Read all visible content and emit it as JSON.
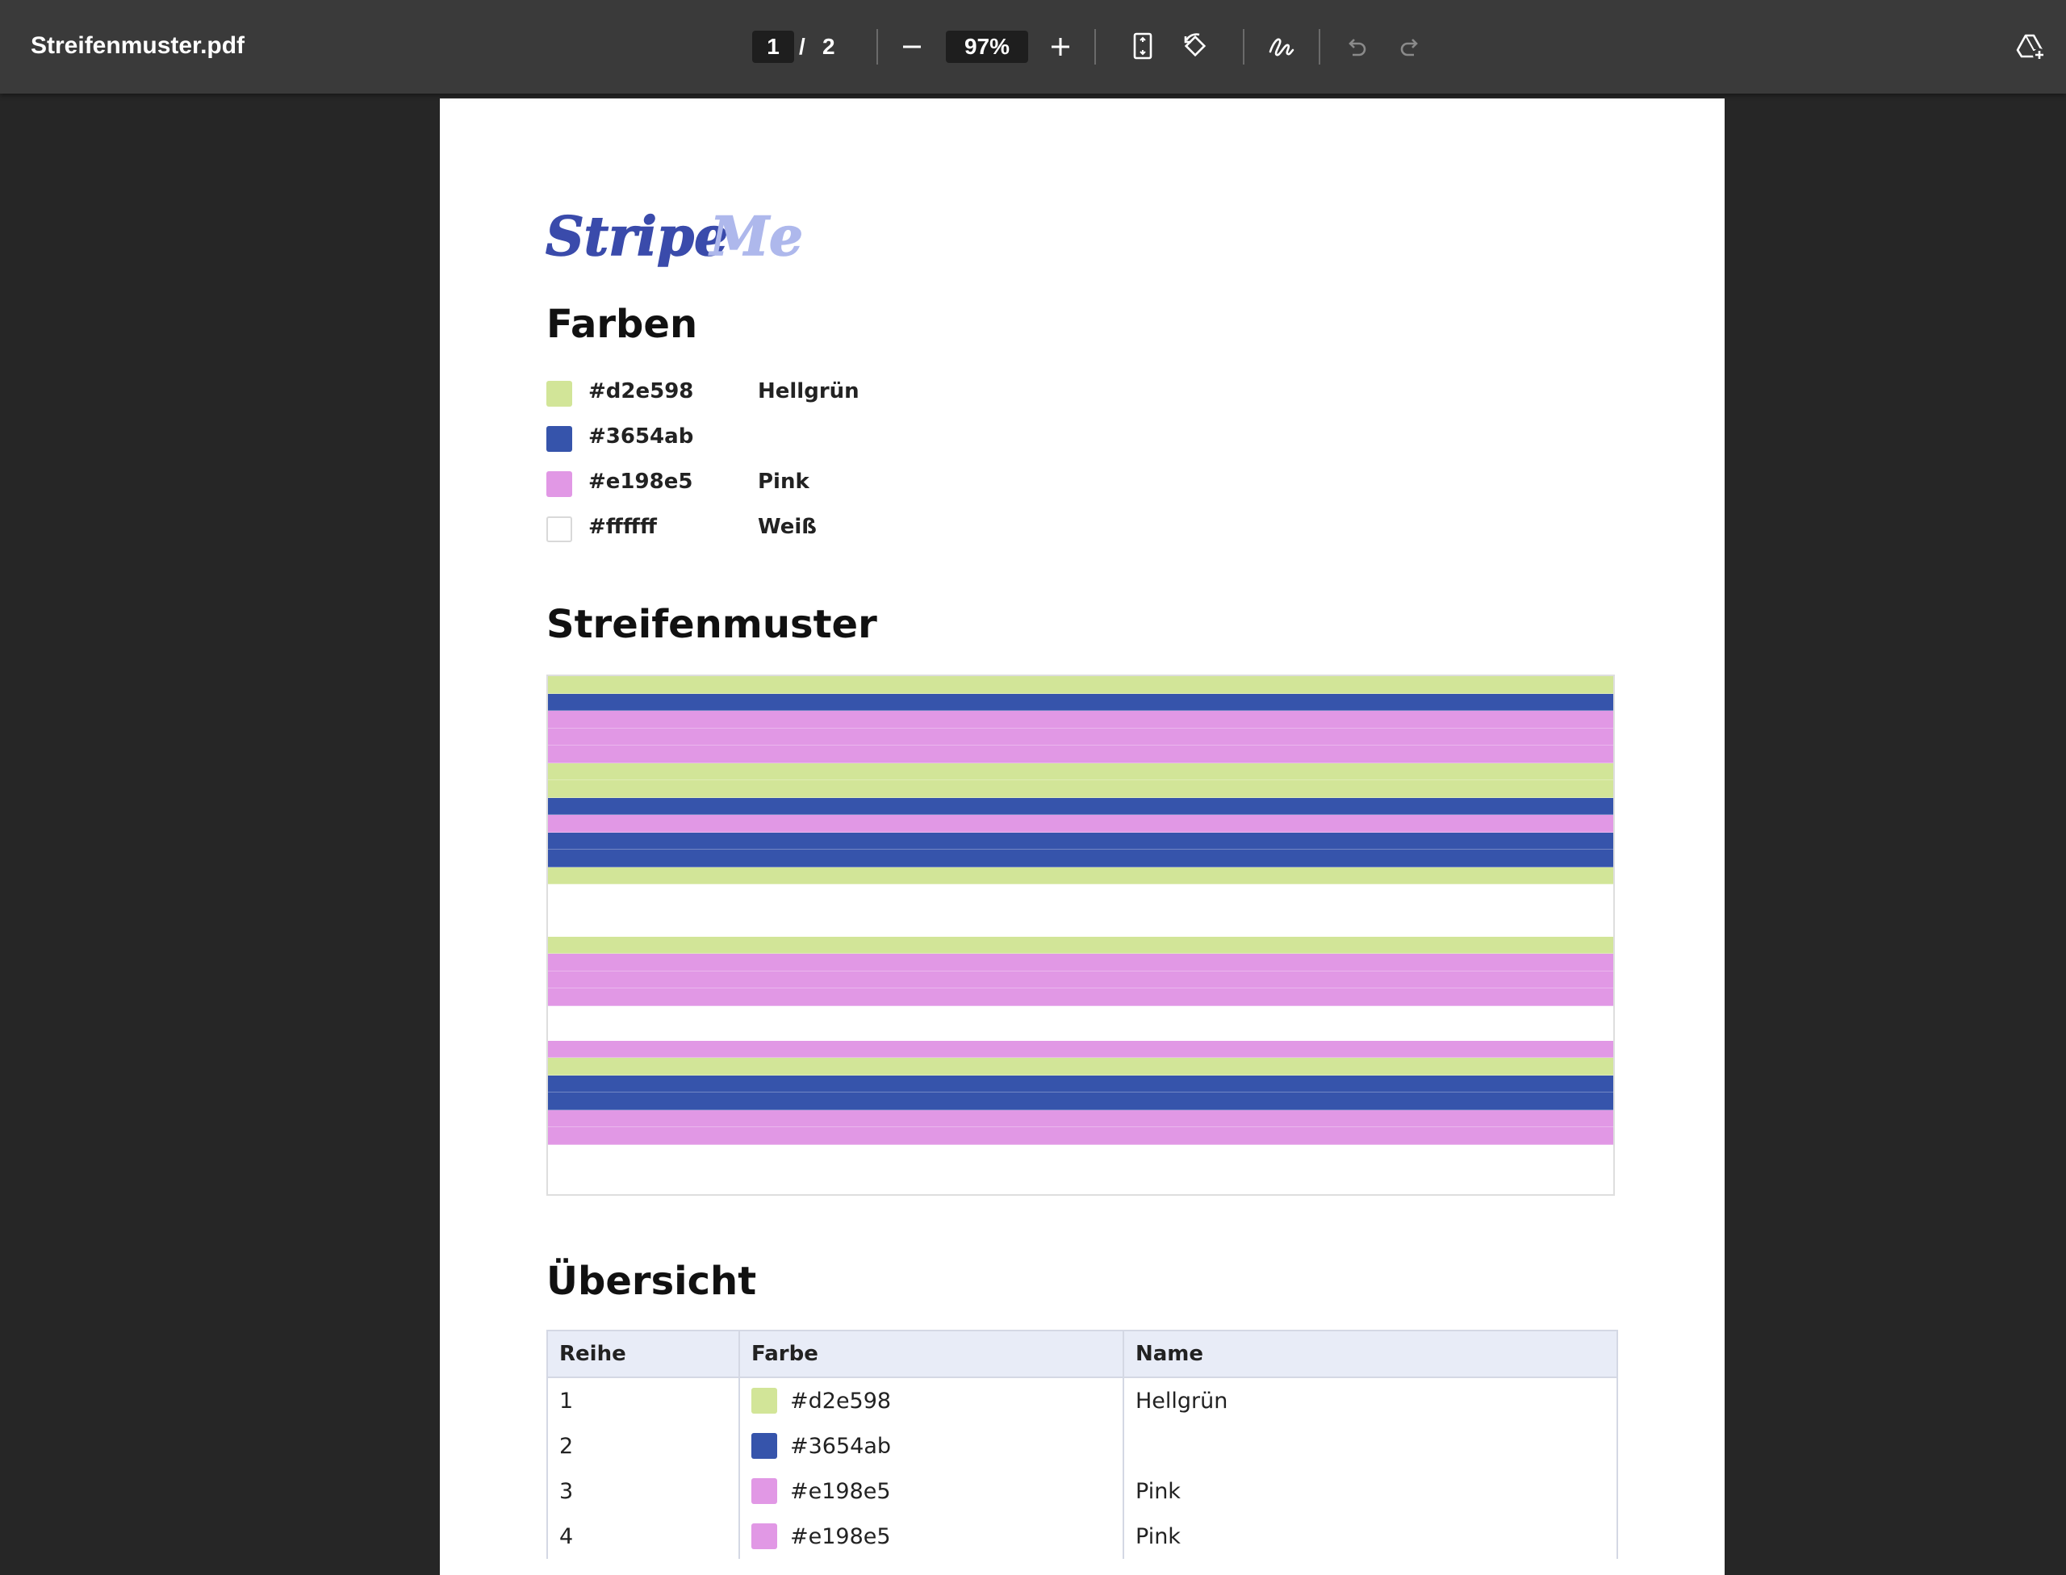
{
  "toolbar": {
    "file_name": "Streifenmuster.pdf",
    "current_page": "1",
    "page_separator": "/",
    "total_pages": "2",
    "zoom": "97%"
  },
  "logo": {
    "part1": "Stripe",
    "part2": "Me",
    "colors": {
      "part1": "#3a4bab",
      "part2": "#aeb8ec"
    }
  },
  "sections": {
    "farben": "Farben",
    "streifenmuster": "Streifenmuster",
    "uebersicht": "Übersicht"
  },
  "colors": [
    {
      "hex": "#d2e598",
      "name": "Hellgrün",
      "swatch": "#d2e598"
    },
    {
      "hex": "#3654ab",
      "name": "",
      "swatch": "#3654ab"
    },
    {
      "hex": "#e198e5",
      "name": "Pink",
      "swatch": "#e198e5"
    },
    {
      "hex": "#ffffff",
      "name": "Weiß",
      "swatch": "#ffffff"
    }
  ],
  "stripe_pattern": [
    "#d2e598",
    "#3654ab",
    "#e198e5",
    "#e198e5",
    "#e198e5",
    "#d2e598",
    "#d2e598",
    "#3654ab",
    "#e198e5",
    "#3654ab",
    "#3654ab",
    "#d2e598",
    "#ffffff",
    "#ffffff",
    "#ffffff",
    "#d2e598",
    "#e198e5",
    "#e198e5",
    "#e198e5",
    "#ffffff",
    "#ffffff",
    "#e198e5",
    "#d2e598",
    "#3654ab",
    "#3654ab",
    "#e198e5",
    "#e198e5",
    "#ffffff",
    "#ffffff",
    "#ffffff"
  ],
  "table": {
    "headers": {
      "row": "Reihe",
      "color": "Farbe",
      "name": "Name"
    },
    "rows": [
      {
        "row": "1",
        "hex": "#d2e598",
        "name": "Hellgrün",
        "swatch": "#d2e598"
      },
      {
        "row": "2",
        "hex": "#3654ab",
        "name": "",
        "swatch": "#3654ab"
      },
      {
        "row": "3",
        "hex": "#e198e5",
        "name": "Pink",
        "swatch": "#e198e5"
      },
      {
        "row": "4",
        "hex": "#e198e5",
        "name": "Pink",
        "swatch": "#e198e5"
      }
    ]
  },
  "icons": {
    "zoom_out": "minus-icon",
    "zoom_in": "plus-icon",
    "fit_page": "fit-page-icon",
    "rotate": "rotate-icon",
    "annotate": "pen-signature-icon",
    "undo": "undo-icon",
    "redo": "redo-icon",
    "drive": "add-to-drive-icon"
  }
}
